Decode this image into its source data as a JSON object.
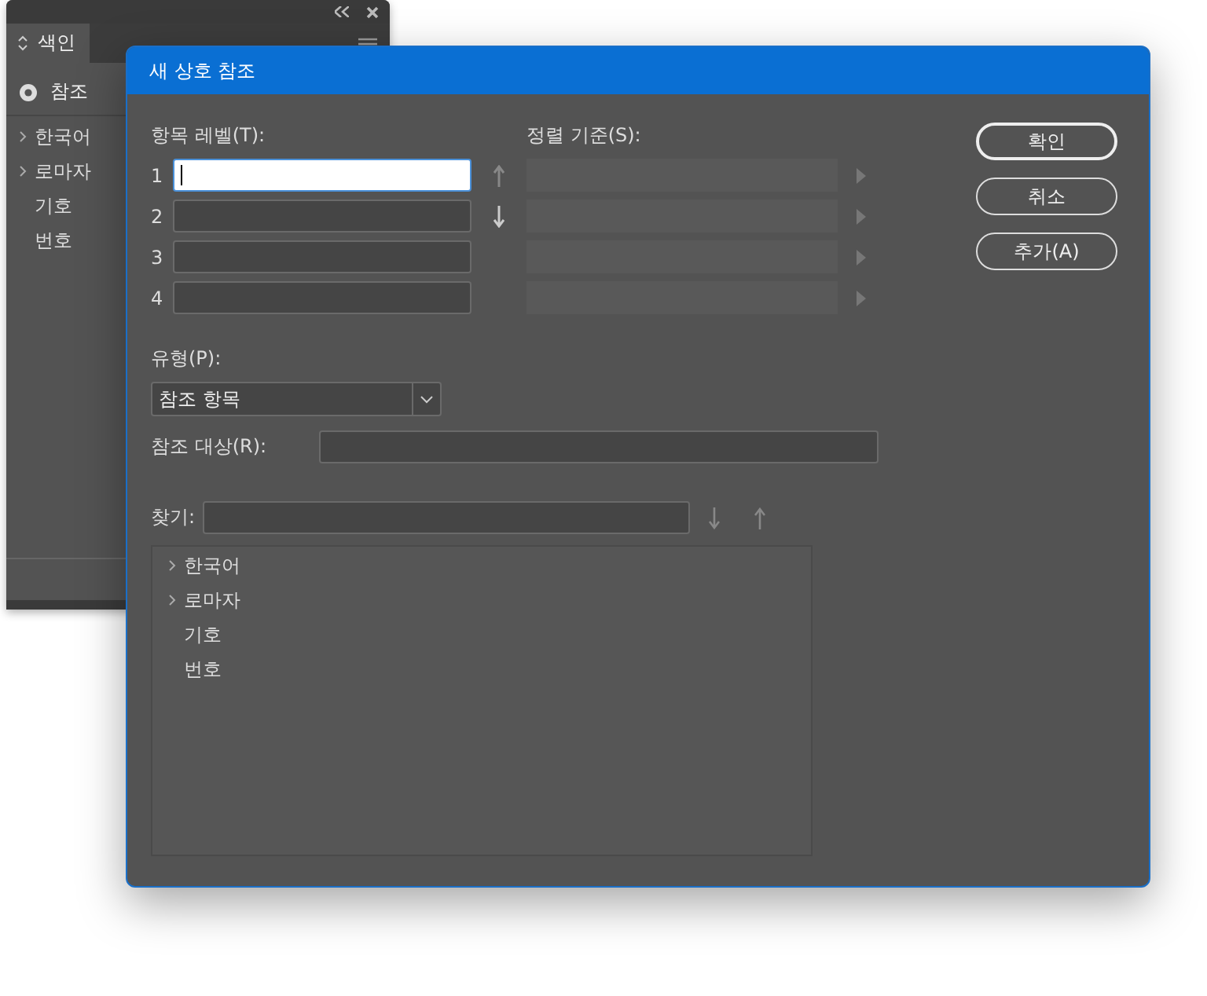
{
  "panel": {
    "tab": {
      "label": "색인",
      "selected": true
    },
    "reference_option": {
      "label": "참조",
      "selected": true
    },
    "items": [
      {
        "label": "한국어",
        "expandable": true
      },
      {
        "label": "로마자",
        "expandable": true
      },
      {
        "label": "기호",
        "expandable": false
      },
      {
        "label": "번호",
        "expandable": false
      }
    ]
  },
  "dialog": {
    "title": "새 상호 참조",
    "entry_levels_label": "항목 레벨(T):",
    "levels": [
      {
        "number": "1",
        "focused": true
      },
      {
        "number": "2",
        "focused": false
      },
      {
        "number": "3",
        "focused": false
      },
      {
        "number": "4",
        "focused": false
      }
    ],
    "sort_by_label": "정렬 기준(S):",
    "type_label": "유형(P):",
    "type_value": "참조 항목",
    "reference_target_label": "참조 대상(R):",
    "find_label": "찾기:",
    "tree": [
      {
        "label": "한국어",
        "expandable": true
      },
      {
        "label": "로마자",
        "expandable": true
      },
      {
        "label": "기호",
        "expandable": false
      },
      {
        "label": "번호",
        "expandable": false
      }
    ],
    "buttons": [
      {
        "label": "확인",
        "default": true
      },
      {
        "label": "취소",
        "default": false
      },
      {
        "label": "추가(A)",
        "default": false
      }
    ]
  }
}
